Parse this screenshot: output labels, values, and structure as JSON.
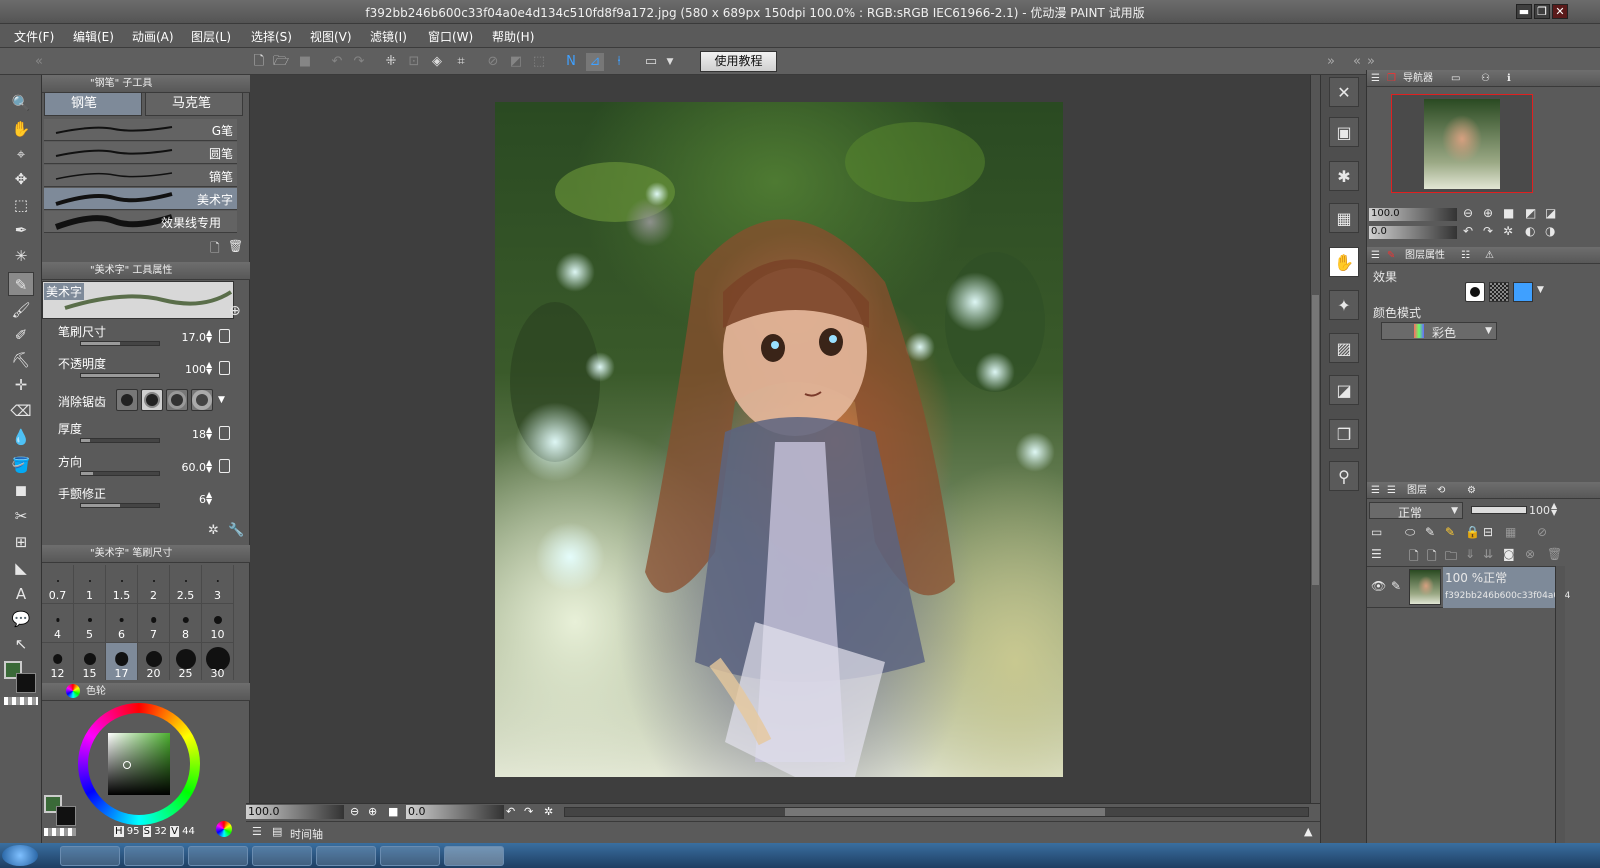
{
  "window": {
    "title": "f392bb246b600c33f04a0e4d134c510fd8f9a172.jpg (580 x 689px 150dpi 100.0% : RGB:sRGB IEC61966-2.1) - 优动漫 PAINT 试用版",
    "controls": [
      "▬",
      "❐",
      "✕"
    ]
  },
  "menu": [
    "文件(F)",
    "编辑(E)",
    "动画(A)",
    "图层(L)",
    "选择(S)",
    "视图(V)",
    "滤镜(I)",
    "窗口(W)",
    "帮助(H)"
  ],
  "toolbar": {
    "tutorial_label": "使用教程",
    "icons": [
      "new-file-icon",
      "open-file-icon",
      "save-icon",
      "undo-icon",
      "redo-icon",
      "transform-icon",
      "scale-icon",
      "fill-icon",
      "crop-icon",
      "clear-icon",
      "hide-icon",
      "select-all-icon",
      "pen-mode-icon",
      "snap-ruler-icon",
      "snap-icon",
      "layout-icon"
    ]
  },
  "tools": [
    "🔍",
    "✋",
    "⌖",
    "✥",
    "⬚",
    "✒",
    "✳",
    "✎",
    "🖌",
    "✐",
    "⛏",
    "✛",
    "⌫",
    "💧",
    "🪣",
    "◼",
    "✂",
    "⊞",
    "◣",
    "A",
    "💬",
    "↖"
  ],
  "subtool_panel": {
    "header": "\"钢笔\" 子工具",
    "tabs": [
      "钢笔",
      "马克笔"
    ],
    "brushes": [
      "G笔",
      "圆笔",
      "镝笔",
      "美术字",
      "效果线专用"
    ],
    "selected_brush_index": 3
  },
  "tool_property": {
    "header": "\"美术字\" 工具属性",
    "preview_label": "美术字",
    "rows": [
      {
        "label": "笔刷尺寸",
        "value": "17.0",
        "fill": 0.5
      },
      {
        "label": "不透明度",
        "value": "100",
        "fill": 1.0
      },
      {
        "label": "消除锯齿",
        "value": "",
        "fill": 0
      },
      {
        "label": "厚度",
        "value": "18",
        "fill": 0.12
      },
      {
        "label": "方向",
        "value": "60.0",
        "fill": 0.15
      },
      {
        "label": "手颤修正",
        "value": "6",
        "fill": 0.5
      }
    ],
    "antialias_selected_index": 1
  },
  "brush_size": {
    "header": "\"美术字\" 笔刷尺寸",
    "sizes": [
      "0.7",
      "1",
      "1.5",
      "2",
      "2.5",
      "3",
      "4",
      "5",
      "6",
      "7",
      "8",
      "10",
      "12",
      "15",
      "17",
      "20",
      "25",
      "30"
    ],
    "selected": "17"
  },
  "color": {
    "tab_label": "色轮",
    "main_color": "#3a6a38",
    "sub_color": "#111111",
    "readout": {
      "H_label": "H",
      "H": "95",
      "S_label": "S",
      "S": "32",
      "V_label": "V",
      "V": "44"
    }
  },
  "canvas": {
    "zoom": "100.0",
    "rotation": "0.0",
    "timeline_label": "时间轴"
  },
  "navigator": {
    "tab_label": "导航器",
    "zoom": "100.0",
    "rotation": "0.0"
  },
  "layer_property": {
    "tab_label": "图层属性",
    "effect_label": "效果",
    "color_mode_label": "颜色模式",
    "color_mode_value": "彩色"
  },
  "layers": {
    "tab_label": "图层",
    "blend_mode": "正常",
    "opacity": "100",
    "items": [
      {
        "name": "100 %正常",
        "file": "f392bb246b600c33f04a0e4"
      }
    ]
  },
  "accent_colors": {
    "selection_blue": "#7e8a99",
    "nav_frame": "#e02020"
  }
}
